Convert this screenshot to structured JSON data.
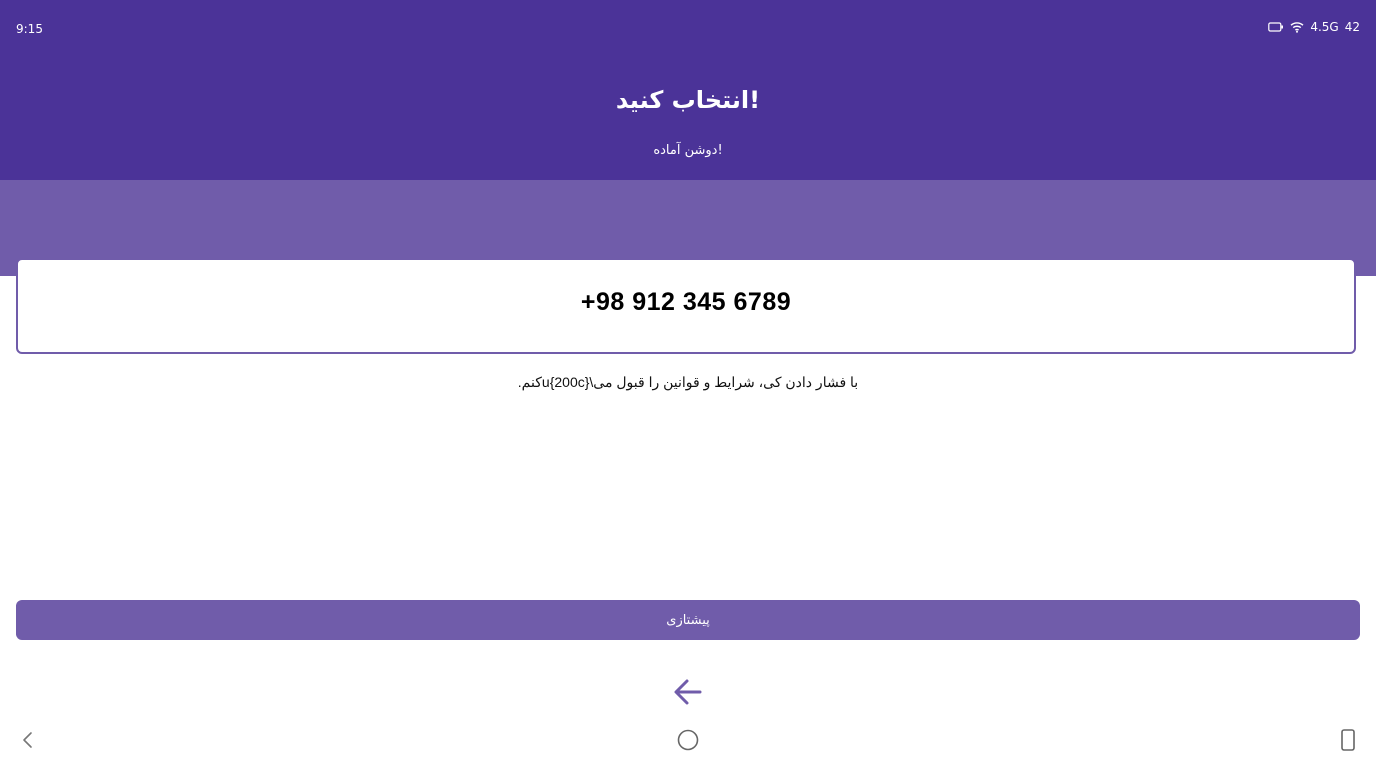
{
  "status_bar": {
    "time": "9:15",
    "network": "4.5G",
    "battery": "42",
    "icons": [
      "battery-icon",
      "wifi-icon"
    ]
  },
  "header": {
    "title": "!انتخاب کنید",
    "subtitle": "!دوشن آماده"
  },
  "phone": {
    "number": "+98 912 345 6789"
  },
  "terms": {
    "text": "با فشار دادن کی، شرایط و قوانین را قبول می\\u{200c}کنم."
  },
  "continue_button": {
    "label": "پیشتازی"
  },
  "bottom": {
    "back_icon": "arrow-left-icon"
  },
  "nav_bar": {
    "icons": [
      "chevron-left-icon",
      "home-circle-icon",
      "recents-icon"
    ]
  },
  "colors": {
    "header_bg": "#4b3398",
    "accent": "#705caa",
    "text_dark": "#111111",
    "white": "#ffffff"
  }
}
